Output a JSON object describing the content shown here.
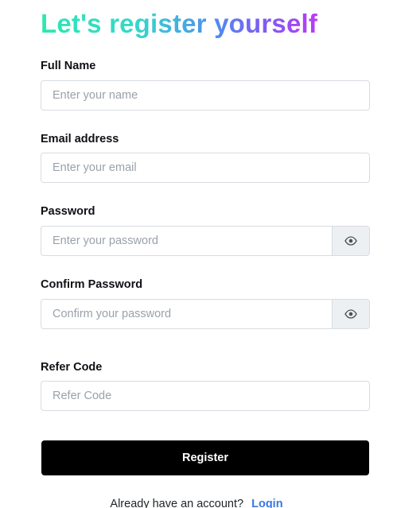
{
  "title": "Let's register yourself",
  "fields": {
    "full_name": {
      "label": "Full Name",
      "placeholder": "Enter your name",
      "value": ""
    },
    "email": {
      "label": "Email address",
      "placeholder": "Enter your email",
      "value": ""
    },
    "password": {
      "label": "Password",
      "placeholder": "Enter your password",
      "value": ""
    },
    "confirm_password": {
      "label": "Confirm Password",
      "placeholder": "Confirm your password",
      "value": ""
    },
    "refer_code": {
      "label": "Refer Code",
      "placeholder": "Refer Code",
      "value": ""
    }
  },
  "icons": {
    "password_toggle": "eye-icon",
    "confirm_password_toggle": "eye-icon"
  },
  "register_button": "Register",
  "footer": {
    "prompt": "Already have an account?",
    "login_link": "Login"
  },
  "colors": {
    "title_gradient": [
      "#2be8b0",
      "#4d8ff0",
      "#b83cf6"
    ],
    "button_bg": "#000000",
    "link": "#3a77e4"
  }
}
